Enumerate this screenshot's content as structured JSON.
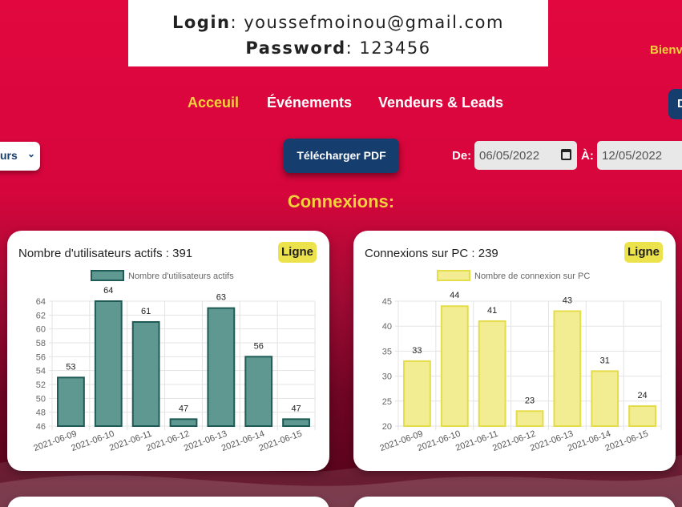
{
  "credentials": {
    "login_label": "Login",
    "login_value": "youssefmoinou@gmail.com",
    "password_label": "Password",
    "password_value": "123456"
  },
  "header": {
    "welcome": "Bienvenue"
  },
  "nav": {
    "items": [
      {
        "label": "Acceuil",
        "active": true
      },
      {
        "label": "Événements",
        "active": false
      },
      {
        "label": "Vendeurs & Leads",
        "active": false
      }
    ],
    "right_button": "D"
  },
  "filters": {
    "select_value": "urs",
    "pdf_button": "Télécharger PDF",
    "from_label": "De:",
    "from_value": "06/05/2022",
    "to_label": "À:",
    "to_value": "12/05/2022"
  },
  "section": {
    "title": "Connexions:"
  },
  "cards": [
    {
      "title": "Nombre d'utilisateurs actifs : 391",
      "button": "Ligne"
    },
    {
      "title": "Connexions sur PC : 239",
      "button": "Ligne"
    }
  ],
  "chart_data": [
    {
      "type": "bar",
      "legend": "Nombre d'utilisateurs actifs",
      "categories": [
        "2021-06-09",
        "2021-06-10",
        "2021-06-11",
        "2021-06-12",
        "2021-06-13",
        "2021-06-14",
        "2021-06-15"
      ],
      "values": [
        53,
        64,
        61,
        47,
        63,
        56,
        47
      ],
      "ylim": [
        46,
        64
      ],
      "yticks": [
        46,
        48,
        50,
        52,
        54,
        56,
        58,
        60,
        62,
        64
      ],
      "color": "#5f9891",
      "border": "#1e5b56",
      "grid": true,
      "legend_position": "top"
    },
    {
      "type": "bar",
      "legend": "Nombre de connexion sur PC",
      "categories": [
        "2021-06-09",
        "2021-06-10",
        "2021-06-11",
        "2021-06-12",
        "2021-06-13",
        "2021-06-14",
        "2021-06-15"
      ],
      "values": [
        33,
        44,
        41,
        23,
        43,
        31,
        24
      ],
      "ylim": [
        20,
        45
      ],
      "yticks": [
        20,
        25,
        30,
        35,
        40,
        45
      ],
      "color": "#f2ec93",
      "border": "#e5dc4a",
      "grid": true,
      "legend_position": "top"
    }
  ],
  "colors": {
    "accent_yellow": "#f5d23c",
    "navy": "#153e6e",
    "crimson": "#e2073f"
  }
}
